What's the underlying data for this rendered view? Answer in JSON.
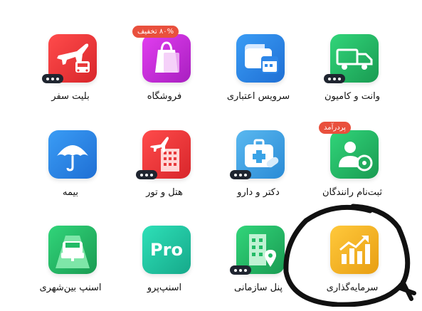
{
  "items": [
    {
      "label": "بلیت سفر",
      "icon": "plane-bus-icon",
      "color": "#e8393b"
    },
    {
      "label": "فروشگاه",
      "icon": "shopping-bag-icon",
      "color": "#c22dd1",
      "badge": "۸۰% تخفیف"
    },
    {
      "label": "سرویس اعتباری",
      "icon": "wallet-calendar-icon",
      "color": "#2d86e8"
    },
    {
      "label": "وانت و کامیون",
      "icon": "truck-icon",
      "color": "#22bb66"
    },
    {
      "label": "بیمه",
      "icon": "umbrella-icon",
      "color": "#2d86e8"
    },
    {
      "label": "هتل و تور",
      "icon": "hotel-plane-icon",
      "color": "#e8393b"
    },
    {
      "label": "دکتر و دارو",
      "icon": "medical-kit-icon",
      "color": "#3aa3e6"
    },
    {
      "label": "ثبت‌نام رانندگان",
      "icon": "driver-wheel-icon",
      "color": "#22bb66",
      "badge": "پردرآمد"
    },
    {
      "label": "اسنپ بین‌شهری",
      "icon": "highway-car-icon",
      "color": "#22bb66"
    },
    {
      "label": "اسنپ‌پرو",
      "icon": "pro-icon",
      "color": "#1ec7a4",
      "pro_text": "Pro"
    },
    {
      "label": "پنل سازمانی",
      "icon": "building-pin-icon",
      "color": "#22bb66"
    },
    {
      "label": "سرمایه‌گذاری",
      "icon": "growth-chart-icon",
      "color": "#f0b429"
    }
  ]
}
